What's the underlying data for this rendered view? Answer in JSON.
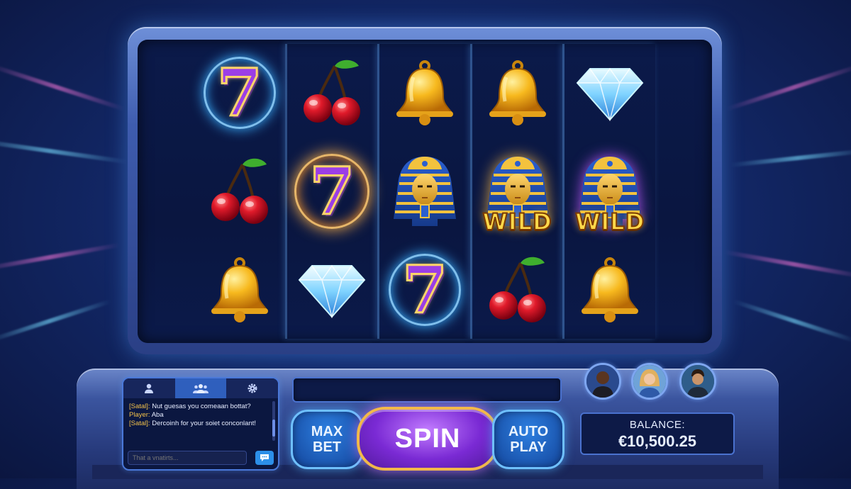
{
  "colors": {
    "accent_purple": "#7a2ad4",
    "accent_gold": "#f2b94a",
    "accent_blue": "#2d7fe0",
    "background": "#13296a"
  },
  "reels": [
    {
      "symbols": [
        "seven",
        "cherry",
        "bell"
      ],
      "glow": [
        "blue",
        "none",
        "none"
      ]
    },
    {
      "symbols": [
        "cherry",
        "seven",
        "diamond"
      ],
      "glow": [
        "none",
        "gold",
        "none"
      ]
    },
    {
      "symbols": [
        "bell",
        "pharaoh",
        "seven"
      ],
      "glow": [
        "none",
        "none",
        "blue"
      ]
    },
    {
      "symbols": [
        "bell",
        "pharaoh-wild",
        "cherry"
      ],
      "glow": [
        "none",
        "gold",
        "none"
      ]
    },
    {
      "symbols": [
        "diamond",
        "pharaoh-wild",
        "bell"
      ],
      "glow": [
        "none",
        "purple",
        "none"
      ]
    }
  ],
  "symbols": {
    "seven_text": "7",
    "wild_label": "WILD"
  },
  "chat": {
    "tabs": [
      {
        "icon": "person-icon"
      },
      {
        "icon": "group-icon"
      },
      {
        "icon": "gear-icon"
      }
    ],
    "messages": [
      {
        "sender": "[Satal]:",
        "text": " Nut guesas you comeaan bottat?"
      },
      {
        "sender": "Player:",
        "text": " Aba"
      },
      {
        "sender": "[Satal]:",
        "text": " Dercoinh for your soiet conconlant!"
      }
    ],
    "input_placeholder": "That a vnatirts...",
    "send_icon": "chat-send-icon"
  },
  "controls": {
    "max_bet_line1": "MAX",
    "max_bet_line2": "BET",
    "spin_label": "SPIN",
    "auto_play_line1": "AUTO",
    "auto_play_line2": "PLAY"
  },
  "players": [
    {
      "name": "player-avatar-1"
    },
    {
      "name": "player-avatar-2"
    },
    {
      "name": "player-avatar-3"
    }
  ],
  "balance": {
    "label": "BALANCE:",
    "value": "€10,500.25"
  }
}
